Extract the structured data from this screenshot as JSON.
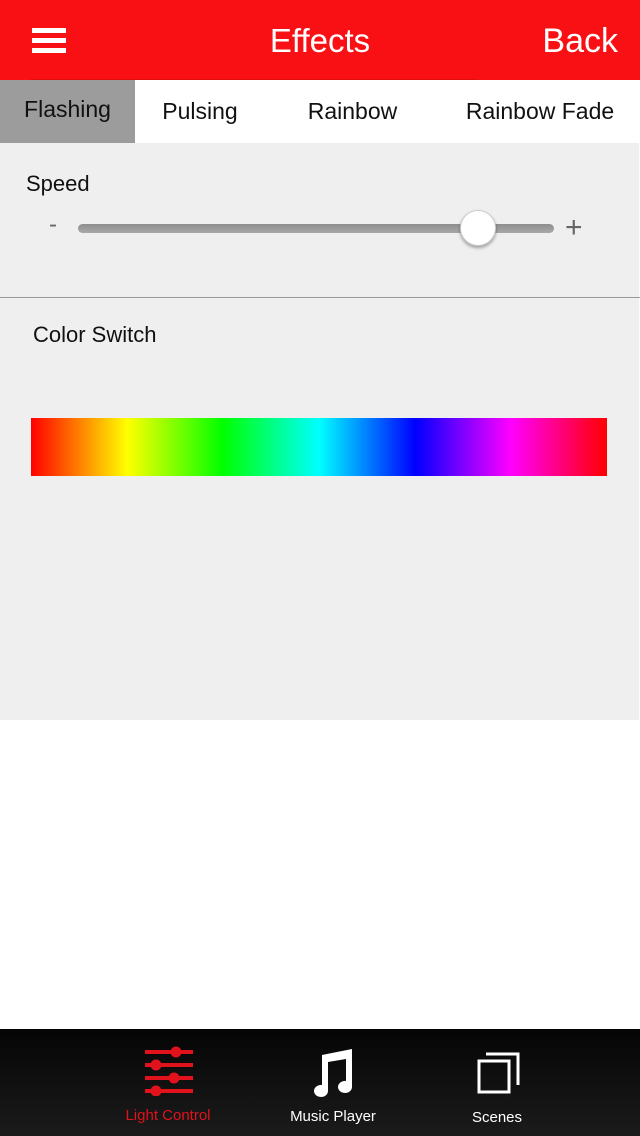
{
  "navbar": {
    "title": "Effects",
    "back_label": "Back",
    "menu_icon": "hamburger-menu-icon",
    "color": "#f91014"
  },
  "tabs": [
    {
      "label": "Flashing",
      "active": true
    },
    {
      "label": "Pulsing",
      "active": false
    },
    {
      "label": "Rainbow",
      "active": false
    },
    {
      "label": "Rainbow Fade",
      "active": false
    }
  ],
  "speed": {
    "label": "Speed",
    "minus_symbol": "-",
    "plus_symbol": "+",
    "value_fraction": 0.84
  },
  "color_switch": {
    "label": "Color Switch",
    "spectrum": [
      "#ff0000",
      "#ffff00",
      "#00ff00",
      "#00ffff",
      "#0000ff",
      "#ff00ff",
      "#ff0000"
    ]
  },
  "tabbar": {
    "items": [
      {
        "label": "Light Control",
        "icon": "sliders-icon",
        "active": true
      },
      {
        "label": "Music Player",
        "icon": "music-note-icon",
        "active": false
      },
      {
        "label": "Scenes",
        "icon": "stacked-squares-icon",
        "active": false
      }
    ],
    "active_color": "#e1121b"
  }
}
